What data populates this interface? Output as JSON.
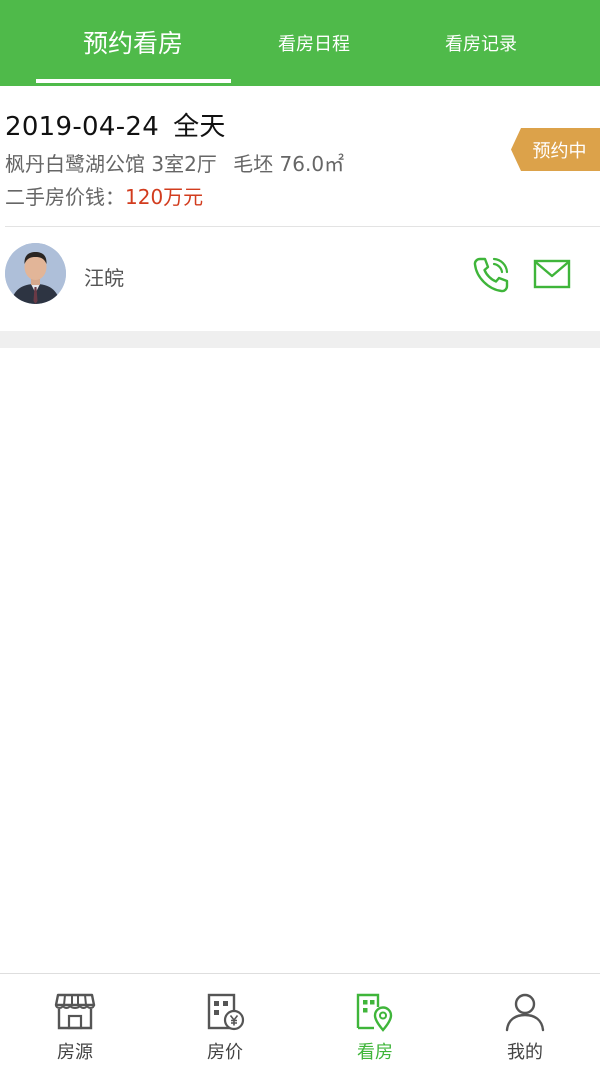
{
  "tabs": [
    {
      "label": "预约看房",
      "active": true
    },
    {
      "label": "看房日程",
      "active": false
    },
    {
      "label": "看房记录",
      "active": false
    }
  ],
  "appointment": {
    "date": "2019-04-24",
    "time_slot": "全天",
    "community": "枫丹白鹭湖公馆",
    "layout": "3室2厅",
    "decoration": "毛坯",
    "area": "76.0㎡",
    "price_label": "二手房价钱：",
    "price_value": "120万元",
    "status": "预约中"
  },
  "agent": {
    "name": "汪皖"
  },
  "bottom_nav": [
    {
      "label": "房源",
      "icon": "storefront-icon",
      "active": false
    },
    {
      "label": "房价",
      "icon": "price-building-icon",
      "active": false
    },
    {
      "label": "看房",
      "icon": "viewing-map-icon",
      "active": true
    },
    {
      "label": "我的",
      "icon": "person-icon",
      "active": false
    }
  ],
  "colors": {
    "brand_green": "#4fba4a",
    "price_red": "#d23c1e",
    "badge_gold": "#dca24a"
  }
}
